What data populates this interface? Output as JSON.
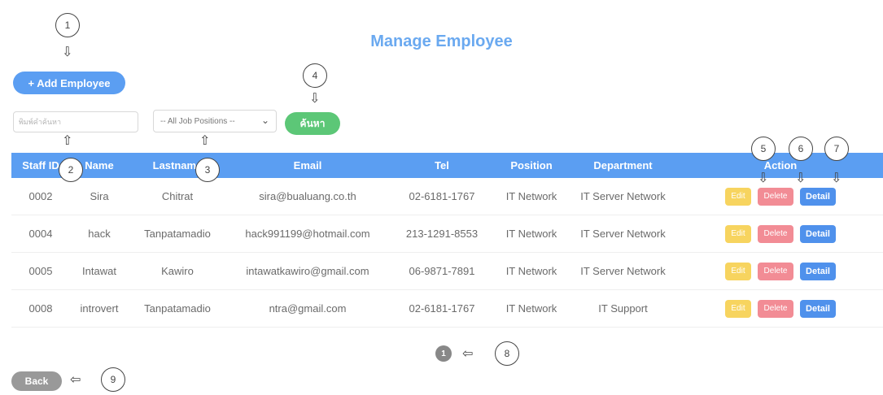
{
  "page": {
    "title": "Manage Employee"
  },
  "toolbar": {
    "add_label": "+ Add Employee",
    "search_placeholder": "พิมพ์คำค้นหา",
    "job_select": "-- All Job Positions --",
    "search_label": "ค้นหา"
  },
  "table": {
    "headers": [
      "Staff ID",
      "Name",
      "Lastname",
      "Email",
      "Tel",
      "Position",
      "Department",
      "Action"
    ],
    "rows": [
      {
        "id": "0002",
        "name": "Sira",
        "lastname": "Chitrat",
        "email": "sira@bualuang.co.th",
        "tel": "02-6181-1767",
        "position": "IT Network",
        "department": "IT Server Network"
      },
      {
        "id": "0004",
        "name": "hack",
        "lastname": "Tanpatamadio",
        "email": "hack991199@hotmail.com",
        "tel": "213-1291-8553",
        "position": "IT Network",
        "department": "IT Server Network"
      },
      {
        "id": "0005",
        "name": "Intawat",
        "lastname": "Kawiro",
        "email": "intawatkawiro@gmail.com",
        "tel": "06-9871-7891",
        "position": "IT Network",
        "department": "IT Server Network"
      },
      {
        "id": "0008",
        "name": "introvert",
        "lastname": "Tanpatamadio",
        "email": "ntra@gmail.com",
        "tel": "02-6181-1767",
        "position": "IT Network",
        "department": "IT Support"
      }
    ],
    "actions": {
      "edit": "Edit",
      "delete": "Delete",
      "detail": "Detail"
    }
  },
  "pagination": {
    "current": "1"
  },
  "footer": {
    "back_label": "Back"
  },
  "callouts": [
    "1",
    "2",
    "3",
    "4",
    "5",
    "6",
    "7",
    "8",
    "9"
  ],
  "colors": {
    "primary": "#5b9ef2",
    "success": "#5cc777",
    "warning": "#f7d45f",
    "danger": "#f28c95",
    "muted": "#999999"
  }
}
